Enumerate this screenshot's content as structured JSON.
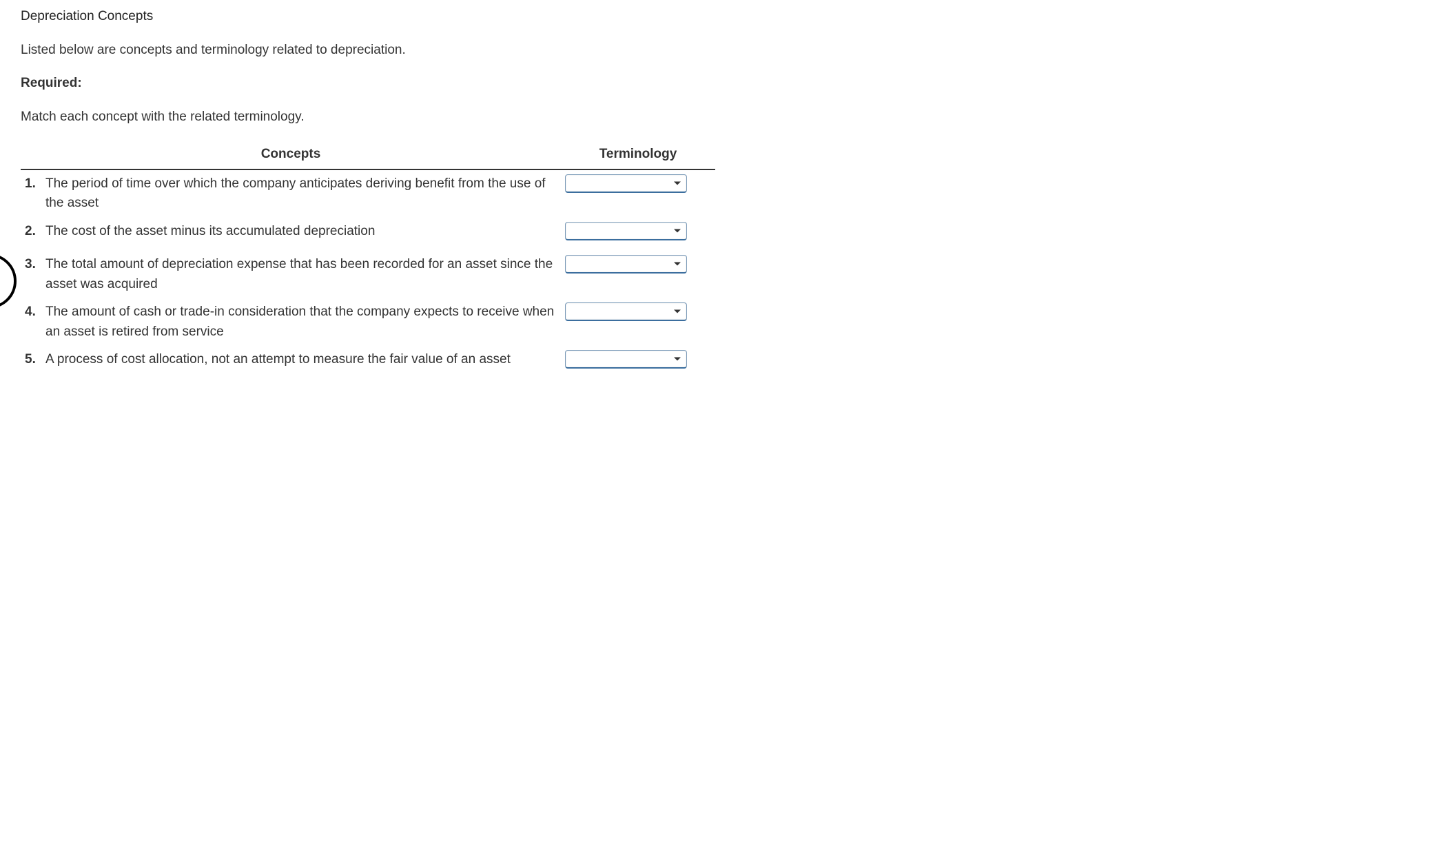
{
  "title": "Depreciation Concepts",
  "intro": "Listed below are concepts and terminology related to depreciation.",
  "required_label": "Required:",
  "instruction": "Match each concept with the related terminology.",
  "headers": {
    "concepts": "Concepts",
    "terminology": "Terminology"
  },
  "rows": [
    {
      "num": "1.",
      "text": "The period of time over which the company anticipates deriving benefit from the use of the asset"
    },
    {
      "num": "2.",
      "text": "The cost of the asset minus its accumulated depreciation"
    },
    {
      "num": "3.",
      "text": "The total amount of depreciation expense that has been recorded for an asset since the asset was acquired"
    },
    {
      "num": "4.",
      "text": "The amount of cash or trade-in consideration that the company expects to receive when an asset is retired from service"
    },
    {
      "num": "5.",
      "text": "A process of cost allocation, not an attempt to measure the fair value of an asset"
    }
  ]
}
